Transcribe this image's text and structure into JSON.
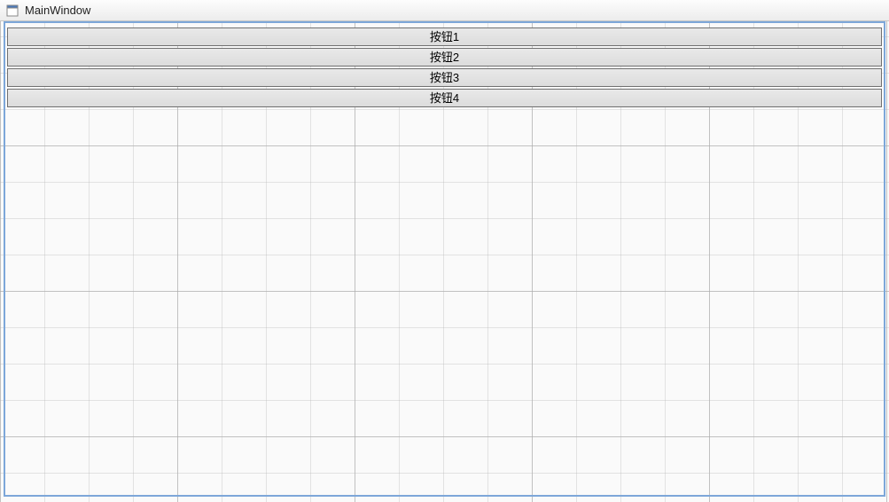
{
  "window": {
    "title": "MainWindow"
  },
  "buttons": {
    "b1": "按钮1",
    "b2": "按钮2",
    "b3": "按钮3",
    "b4": "按钮4"
  }
}
